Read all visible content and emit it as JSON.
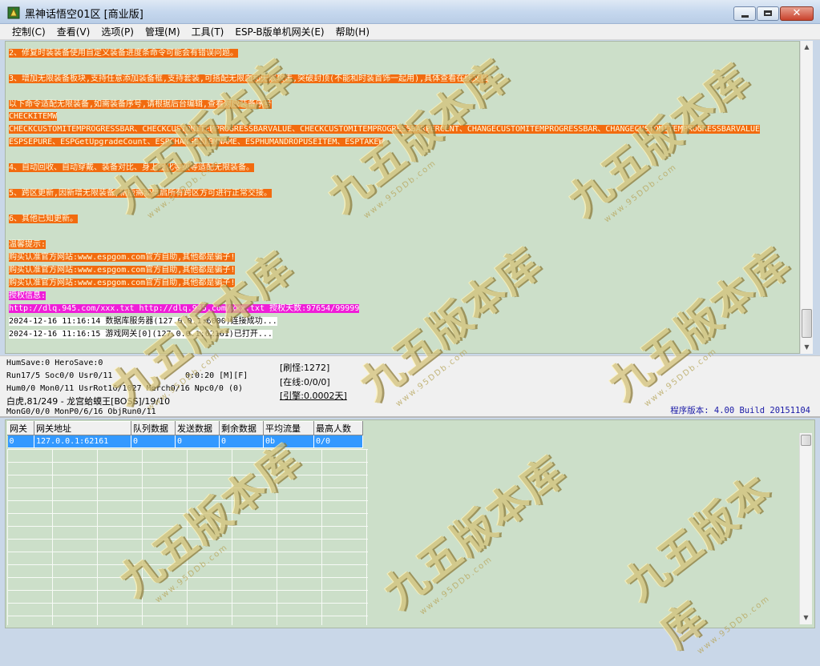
{
  "window": {
    "title": "黑神话悟空01区 [商业版]",
    "close_glyph": "✕"
  },
  "menu": [
    "控制(C)",
    "查看(V)",
    "选项(P)",
    "管理(M)",
    "工具(T)",
    "ESP-B版单机网关(E)",
    "帮助(H)"
  ],
  "log_lines": [
    {
      "text": "2、修复时装装备使用自定义装备进度条命令可能会有错误问题。",
      "style": "orange"
    },
    {
      "text": "3、增加无限装备板块,支持任意添加装备框,支持套装,可搭配无限血和无限攻击,突破封顶(不能和时装首饰一起用),具体查看在线文档",
      "style": "orange"
    },
    {
      "text": "以下命令适配无限装备,如需装备序号,请根据后台编辑,查看对应装备序号",
      "style": "orange"
    },
    {
      "text": "CHECKITEMW",
      "style": "orange"
    },
    {
      "text": "CHECKCUSTOMITEMPROGRESSBAR、CHECKCUSTOMITEMPROGRESSBARVALUE、CHECKCUSTOMITEMPROGRESSBARPERCENT、CHANGECUSTOMITEMPROGRESSBAR、CHANGECUSTOMITEMPROGRESSBARVALUE",
      "style": "orange"
    },
    {
      "text": "ESPSEPURE、ESPGetUpgradeCount、ESPCHANGEITEMNAME、ESPHUMANDROPUSEITEM、ESPTAKEW",
      "style": "orange"
    },
    {
      "text": "4、自动回收、自动穿戴、装备对比、身上强化等级等适配无限装备。",
      "style": "orange"
    },
    {
      "text": "5、跨区更新,因新增无限装备,新版需要重启所有跨区方可进行正常交接。",
      "style": "orange"
    },
    {
      "text": "6、其他已知更新。",
      "style": "orange"
    },
    {
      "text": "温馨提示:",
      "style": "orange"
    },
    {
      "text": "购买认准官方网站:www.espgom.com官方自助,其他都是骗子!",
      "style": "orange"
    },
    {
      "text": "购买认准官方网站:www.espgom.com官方自助,其他都是骗子!",
      "style": "orange"
    },
    {
      "text": "购买认准官方网站:www.espgom.com官方自助,其他都是骗子!",
      "style": "orange"
    },
    {
      "text": "授权信息:",
      "style": "magenta"
    },
    {
      "text": "http://dlq.945.com/xxx.txt http://dlq.945.com/xxx.txt 授权天数:97654/99999",
      "style": "magenta"
    },
    {
      "text": "2024-12-16 11:16:14 数据库服务器(127.0.0.1:6000)连接成功...",
      "style": "white"
    },
    {
      "text": "2024-12-16 11:16:15 游戏网关[0](127.0.0.1:62161)已打开...",
      "style": "white"
    }
  ],
  "status": {
    "hum_save": "HumSave:0 HeroSave:0",
    "run": "Run17/5 Soc0/0 Usr0/11",
    "timer": "0:0:20 [M][F]",
    "hum": "Hum0/0 Mon0/11 UsrRot16/1027 Merch0/16 Npc0/0 (0)",
    "boss": "白虎,81/249 - 龙宫蛤蟆王[BOSS]/19/10",
    "mon": "MonG0/0/0 MonP0/6/16 ObjRun0/11",
    "refresh": "[刷怪:1272]",
    "online": "[在线:0/0/0]",
    "engine": "[引擎:0.0002天]",
    "version": "程序版本: 4.00 Build 20151104"
  },
  "grid": {
    "columns": [
      "网关",
      "网关地址",
      "队列数据",
      "发送数据",
      "剩余数据",
      "平均流量",
      "最高人数"
    ],
    "rows": [
      [
        "0",
        "127.0.0.1:62161",
        "0",
        "0",
        "0",
        "0b",
        "0/0"
      ]
    ]
  },
  "watermark": {
    "main": "九五版本库",
    "sub": "www.95DDb.com"
  },
  "icons": {
    "scroll_up": "▲",
    "scroll_down": "▼"
  }
}
